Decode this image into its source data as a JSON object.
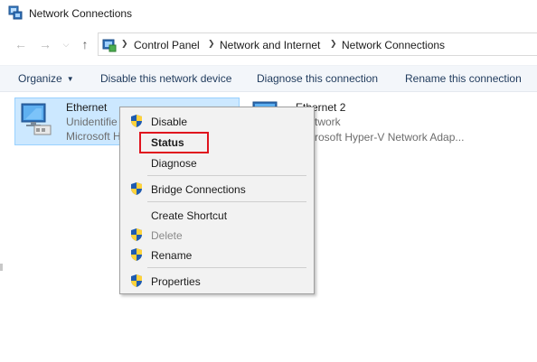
{
  "window": {
    "title": "Network Connections"
  },
  "address_bar": {
    "breadcrumbs": [
      "Control Panel",
      "Network and Internet",
      "Network Connections"
    ]
  },
  "commands": {
    "organize": "Organize",
    "disable": "Disable this network device",
    "diagnose": "Diagnose this connection",
    "rename": "Rename this connection"
  },
  "adapters": [
    {
      "name": "Ethernet",
      "status": "Unidentifie",
      "device": "Microsoft H"
    },
    {
      "name": "Ethernet 2",
      "status": "twork",
      "device": "rosoft Hyper-V Network Adap..."
    }
  ],
  "context_menu": {
    "items": [
      {
        "label": "Disable",
        "shield": true
      },
      {
        "label": "Status",
        "bold": true
      },
      {
        "label": "Diagnose"
      },
      {
        "label": "Bridge Connections",
        "shield": true
      },
      {
        "label": "Create Shortcut"
      },
      {
        "label": "Delete",
        "shield": true,
        "disabled": true
      },
      {
        "label": "Rename",
        "shield": true
      },
      {
        "label": "Properties",
        "shield": true
      }
    ]
  },
  "colors": {
    "selection_bg": "#cce8ff",
    "highlight_box": "#e0141e",
    "command_bar_bg": "#f3f6fa"
  }
}
